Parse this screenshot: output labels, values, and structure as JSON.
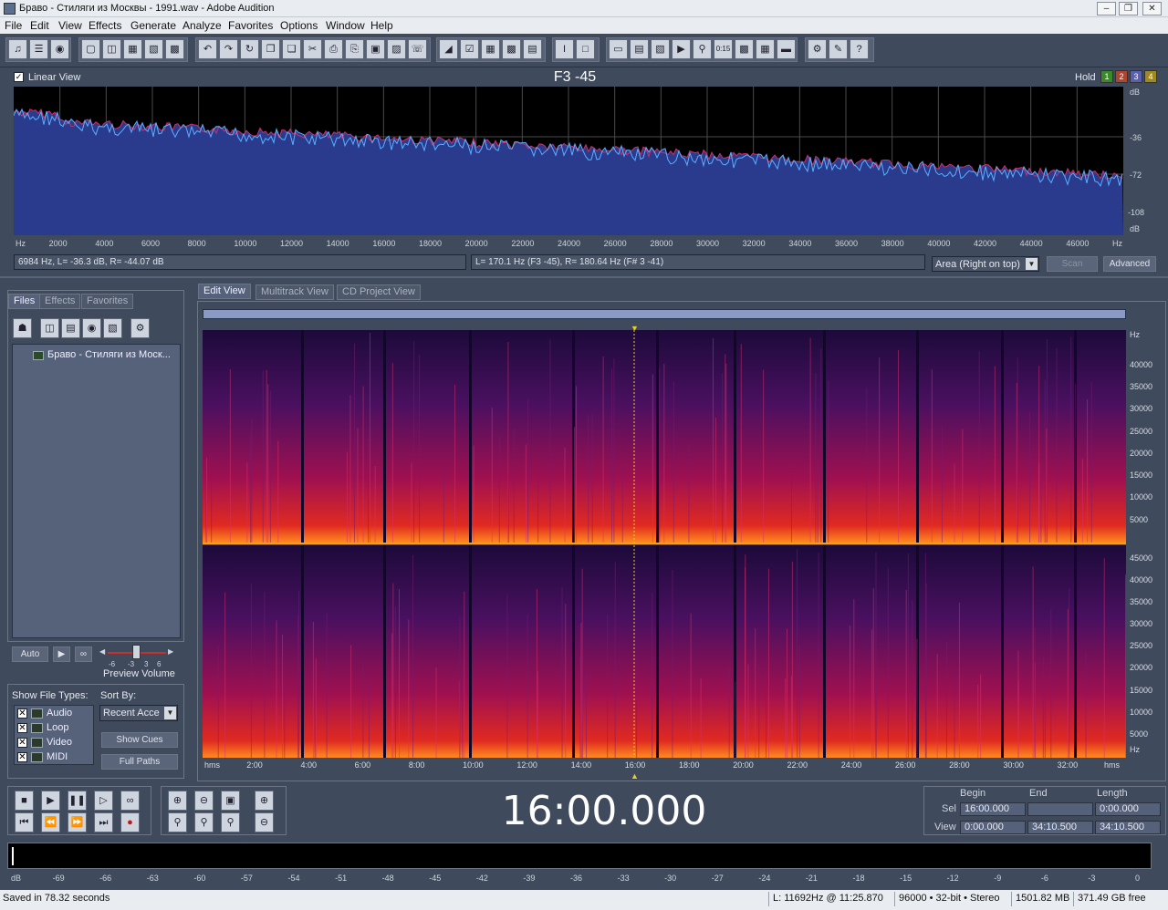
{
  "window": {
    "title": "Браво - Стиляги из Москвы - 1991.wav - Adobe Audition"
  },
  "menu": [
    "File",
    "Edit",
    "View",
    "Effects",
    "Generate",
    "Analyze",
    "Favorites",
    "Options",
    "Window",
    "Help"
  ],
  "analysis": {
    "linear_view": "Linear View",
    "note": "F3 -45",
    "hold": "Hold",
    "hold_buttons": [
      "1",
      "2",
      "3",
      "4"
    ],
    "db_labels": [
      "dB",
      "-36",
      "-72",
      "-108",
      "dB"
    ],
    "hz_labels": [
      "Hz",
      "2000",
      "4000",
      "6000",
      "8000",
      "10000",
      "12000",
      "14000",
      "16000",
      "18000",
      "20000",
      "22000",
      "24000",
      "26000",
      "28000",
      "30000",
      "32000",
      "34000",
      "36000",
      "38000",
      "40000",
      "42000",
      "44000",
      "46000",
      "Hz"
    ],
    "info_left": "6984 Hz, L= -36.3 dB, R= -44.07 dB",
    "info_right": "L= 170.1 Hz (F3 -45), R= 180.64 Hz (F# 3 -41)",
    "area_select": "Area (Right on top)",
    "scan": "Scan",
    "advanced": "Advanced"
  },
  "left_panel": {
    "tabs": [
      "Files",
      "Effects",
      "Favorites"
    ],
    "files": [
      "Браво - Стиляги из Моск..."
    ],
    "auto": "Auto",
    "preview_volume": "Preview Volume",
    "volume_ticks": [
      "-6",
      "-3",
      "3",
      "6"
    ],
    "show_file_types": "Show File Types:",
    "sort_by": "Sort By:",
    "types": [
      "Audio",
      "Loop",
      "Video",
      "MIDI"
    ],
    "sort_value": "Recent Acce",
    "show_cues": "Show Cues",
    "full_paths": "Full Paths"
  },
  "view_tabs": [
    "Edit View",
    "Multitrack View",
    "CD Project View"
  ],
  "spectral": {
    "time_labels": [
      "hms",
      "2:00",
      "4:00",
      "6:00",
      "8:00",
      "10:00",
      "12:00",
      "14:00",
      "16:00",
      "18:00",
      "20:00",
      "22:00",
      "24:00",
      "26:00",
      "28:00",
      "30:00",
      "32:00",
      "hms"
    ],
    "freq_labels_top": [
      "Hz",
      "40000",
      "35000",
      "30000",
      "25000",
      "20000",
      "15000",
      "10000",
      "5000"
    ],
    "freq_labels_bottom": [
      "45000",
      "40000",
      "35000",
      "30000",
      "25000",
      "20000",
      "15000",
      "10000",
      "5000",
      "Hz"
    ]
  },
  "transport": {
    "time": "16:00.000",
    "begin": "Begin",
    "end": "End",
    "length": "Length",
    "sel": "Sel",
    "view": "View",
    "sel_begin": "16:00.000",
    "sel_end": "",
    "sel_length": "0:00.000",
    "view_begin": "0:00.000",
    "view_end": "34:10.500",
    "view_length": "34:10.500"
  },
  "meter": {
    "ticks": [
      "dB",
      "-69",
      "-66",
      "-63",
      "-60",
      "-57",
      "-54",
      "-51",
      "-48",
      "-45",
      "-42",
      "-39",
      "-36",
      "-33",
      "-30",
      "-27",
      "-24",
      "-21",
      "-18",
      "-15",
      "-12",
      "-9",
      "-6",
      "-3",
      "0"
    ]
  },
  "status": {
    "saved": "Saved in 78.32 seconds",
    "cursor": "L: 11692Hz @ 11:25.870",
    "format": "96000 • 32-bit • Stereo",
    "size": "1501.82 MB",
    "free": "371.49 GB free"
  }
}
